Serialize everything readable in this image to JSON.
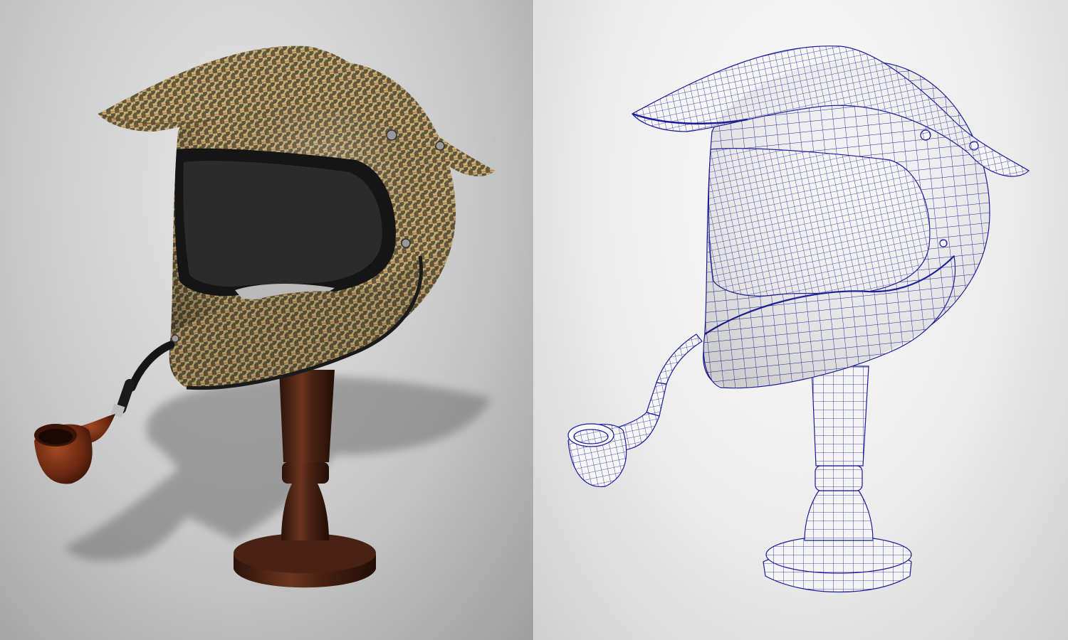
{
  "scene": {
    "panels": [
      {
        "id": "textured-render",
        "style": "houndstooth-textured"
      },
      {
        "id": "wireframe-render",
        "style": "wireframe"
      }
    ]
  },
  "colors": {
    "houndstooth_base": "#c9b27a",
    "houndstooth_dark": "#3c3426",
    "houndstooth_red": "#9c4a25",
    "wood": "#3e1d10",
    "wood_light": "#6b3520",
    "pipe_bowl": "#6e2a12",
    "pipe_stem": "#151515",
    "visor_lining": "#1e1e1e",
    "wire_color": "#1a1a9a",
    "wire_fill": "#f4f4f4"
  },
  "objects": [
    "motocross-helmet",
    "wooden-stand",
    "tobacco-pipe"
  ]
}
